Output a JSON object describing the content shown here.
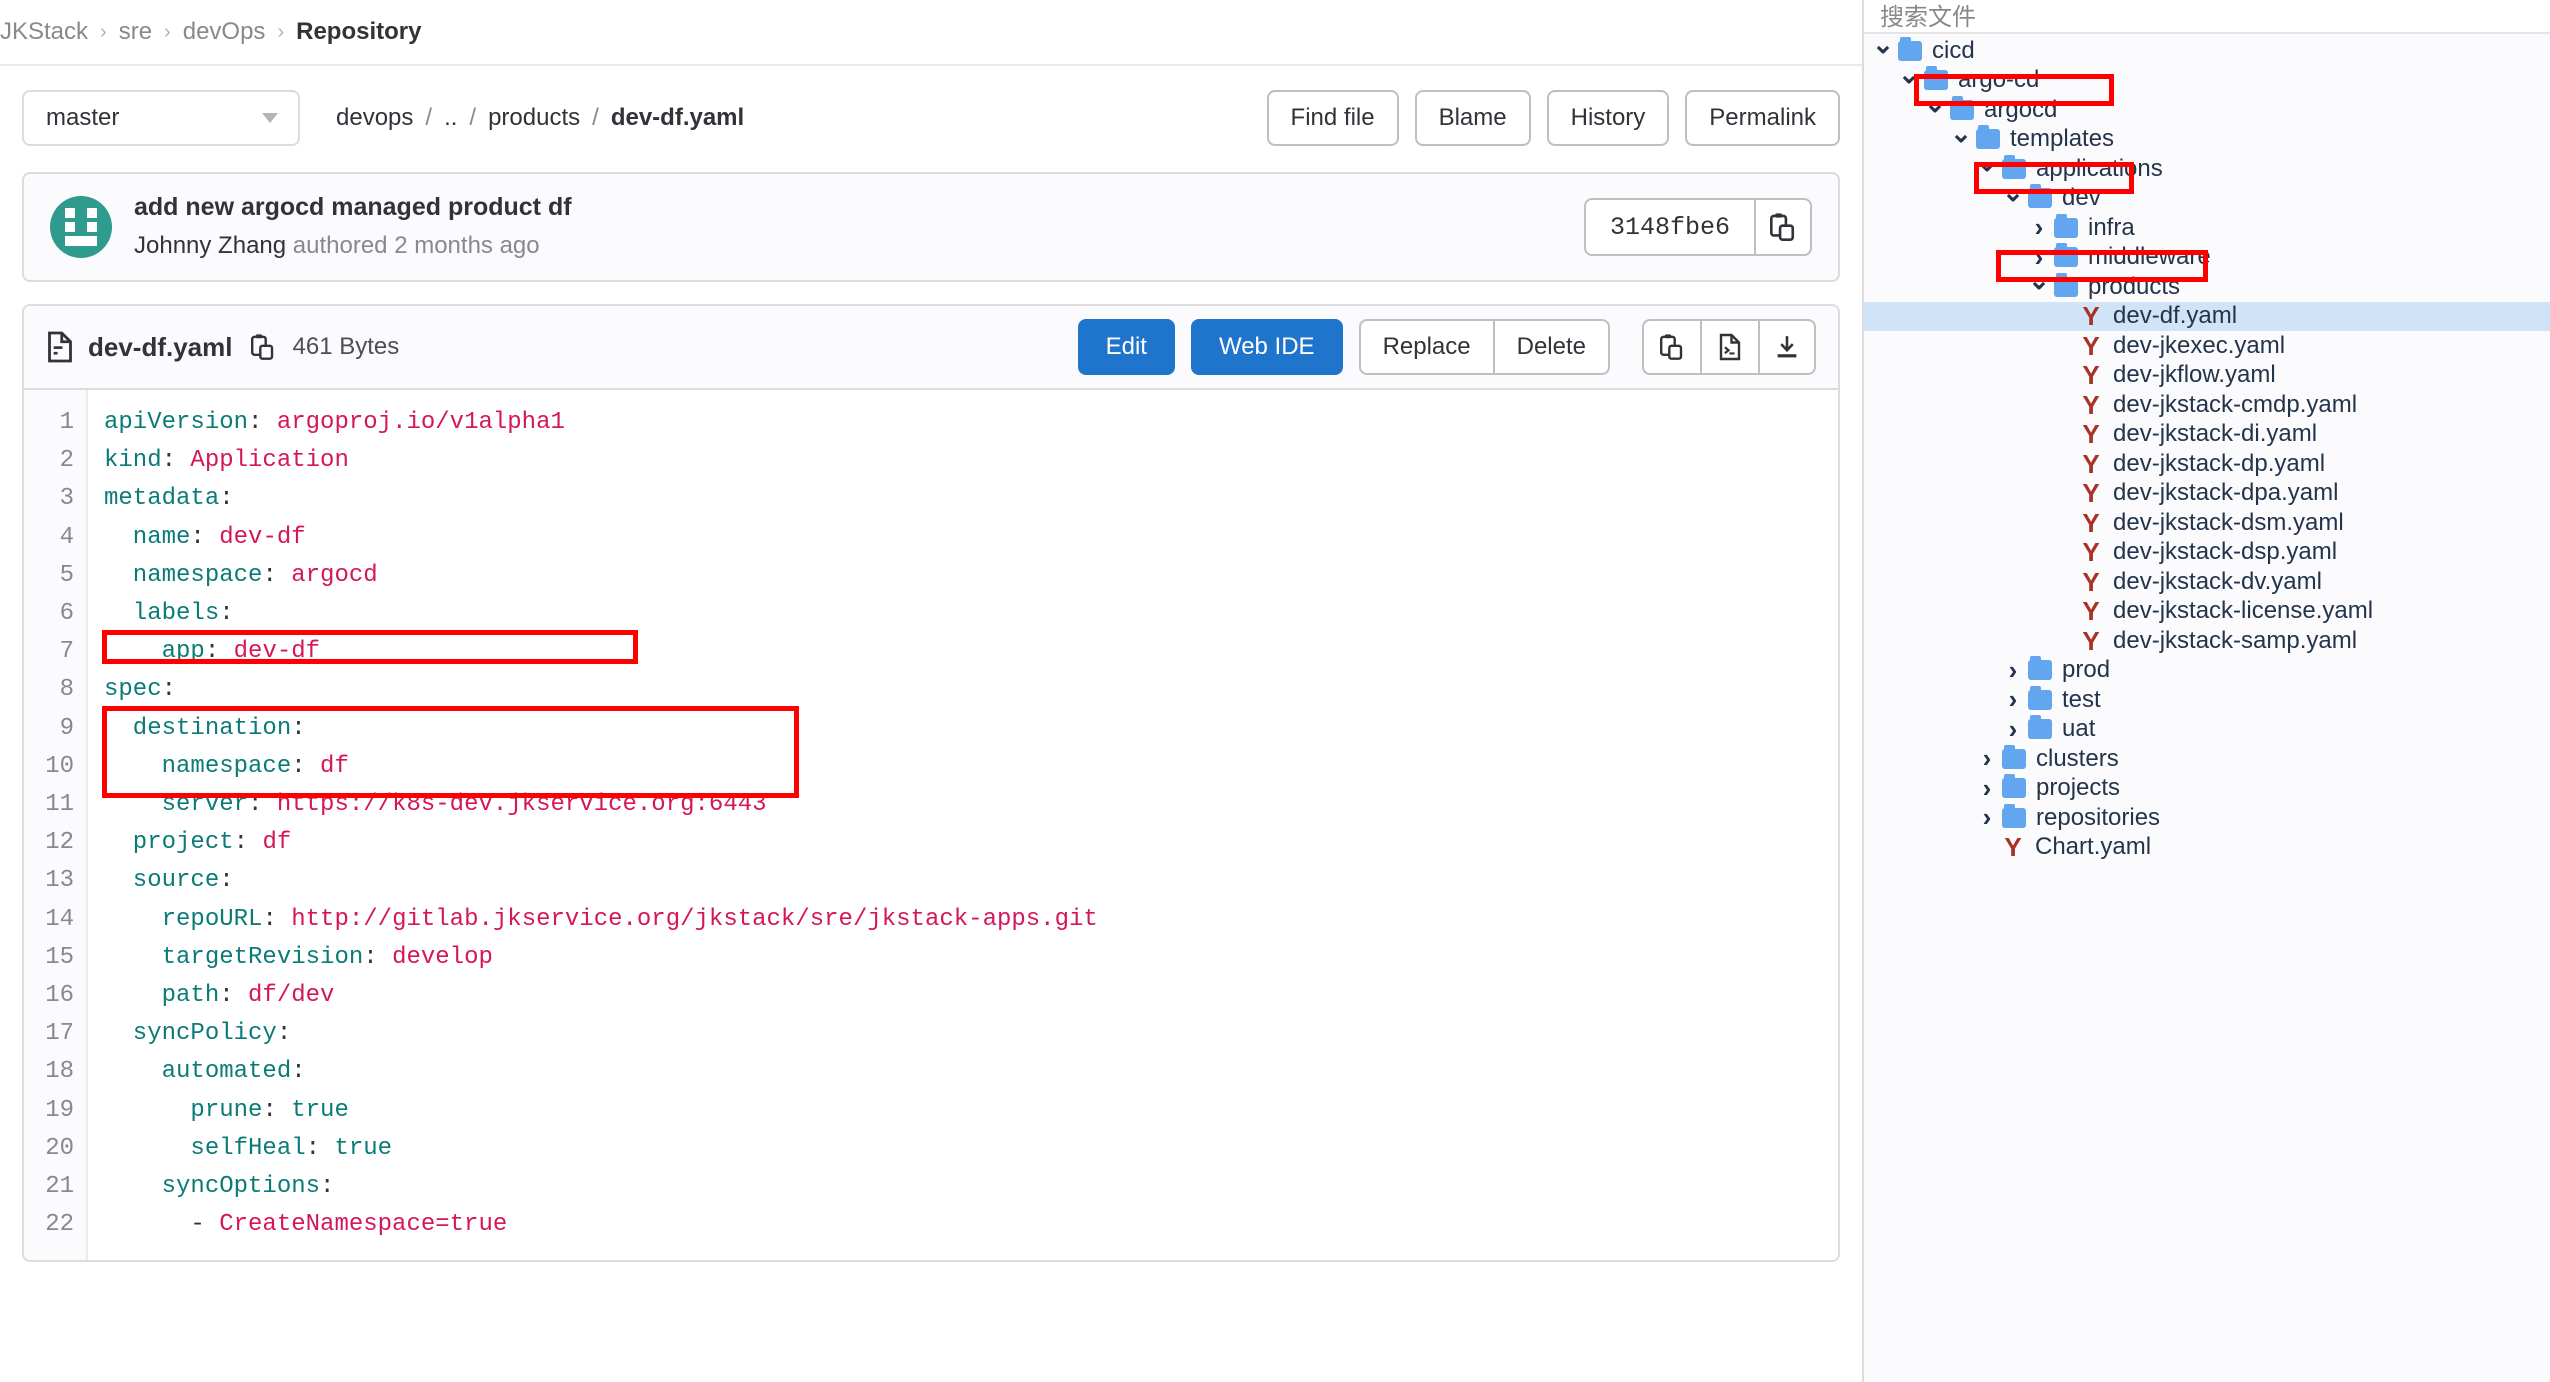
{
  "breadcrumb": {
    "items": [
      "JKStack",
      "sre",
      "devOps",
      "Repository"
    ],
    "separator": "›"
  },
  "toolbar": {
    "branch": "master",
    "path_segments": [
      "devops",
      "..",
      "products",
      "dev-df.yaml"
    ],
    "path_separator": "/",
    "find_file": "Find file",
    "blame": "Blame",
    "history": "History",
    "permalink": "Permalink"
  },
  "commit": {
    "title": "add new argocd managed product df",
    "author": "Johnny Zhang",
    "meta": "authored 2 months ago",
    "sha": "3148fbe6",
    "copy_icon": "clipboard-icon",
    "avatar_icon": "user-avatar"
  },
  "file": {
    "icon": "document-icon",
    "name": "dev-df.yaml",
    "copy_path_icon": "clipboard-icon",
    "size": "461 Bytes",
    "edit": "Edit",
    "web_ide": "Web IDE",
    "replace": "Replace",
    "delete": "Delete",
    "icons": [
      "clipboard-icon",
      "open-raw-icon",
      "download-icon"
    ]
  },
  "code": {
    "language": "yaml",
    "line_numbers": [
      1,
      2,
      3,
      4,
      5,
      6,
      7,
      8,
      9,
      10,
      11,
      12,
      13,
      14,
      15,
      16,
      17,
      18,
      19,
      20,
      21,
      22
    ],
    "lines": [
      {
        "n": 1,
        "indent": 0,
        "key": "apiVersion",
        "value": "argoproj.io/v1alpha1",
        "value_type": "string"
      },
      {
        "n": 2,
        "indent": 0,
        "key": "kind",
        "value": "Application",
        "value_type": "string"
      },
      {
        "n": 3,
        "indent": 0,
        "key": "metadata",
        "value": "",
        "value_type": "map"
      },
      {
        "n": 4,
        "indent": 1,
        "key": "name",
        "value": "dev-df",
        "value_type": "string"
      },
      {
        "n": 5,
        "indent": 1,
        "key": "namespace",
        "value": "argocd",
        "value_type": "string"
      },
      {
        "n": 6,
        "indent": 1,
        "key": "labels",
        "value": "",
        "value_type": "map"
      },
      {
        "n": 7,
        "indent": 2,
        "key": "app",
        "value": "dev-df",
        "value_type": "string"
      },
      {
        "n": 8,
        "indent": 0,
        "key": "spec",
        "value": "",
        "value_type": "map"
      },
      {
        "n": 9,
        "indent": 1,
        "key": "destination",
        "value": "",
        "value_type": "map"
      },
      {
        "n": 10,
        "indent": 2,
        "key": "namespace",
        "value": "df",
        "value_type": "string"
      },
      {
        "n": 11,
        "indent": 2,
        "key": "server",
        "value": "https://k8s-dev.jkservice.org:6443",
        "value_type": "string"
      },
      {
        "n": 12,
        "indent": 1,
        "key": "project",
        "value": "df",
        "value_type": "string"
      },
      {
        "n": 13,
        "indent": 1,
        "key": "source",
        "value": "",
        "value_type": "map"
      },
      {
        "n": 14,
        "indent": 2,
        "key": "repoURL",
        "value": "http://gitlab.jkservice.org/jkstack/sre/jkstack-apps.git",
        "value_type": "string"
      },
      {
        "n": 15,
        "indent": 2,
        "key": "targetRevision",
        "value": "develop",
        "value_type": "string"
      },
      {
        "n": 16,
        "indent": 2,
        "key": "path",
        "value": "df/dev",
        "value_type": "string"
      },
      {
        "n": 17,
        "indent": 1,
        "key": "syncPolicy",
        "value": "",
        "value_type": "map"
      },
      {
        "n": 18,
        "indent": 2,
        "key": "automated",
        "value": "",
        "value_type": "map"
      },
      {
        "n": 19,
        "indent": 3,
        "key": "prune",
        "value": "true",
        "value_type": "bool"
      },
      {
        "n": 20,
        "indent": 3,
        "key": "selfHeal",
        "value": "true",
        "value_type": "bool"
      },
      {
        "n": 21,
        "indent": 2,
        "key": "syncOptions",
        "value": "",
        "value_type": "seq"
      },
      {
        "n": 22,
        "indent": 3,
        "key": "",
        "value": "- CreateNamespace=true",
        "value_type": "item"
      }
    ],
    "annotations": [
      {
        "name": "server-line-highlight",
        "target_line": 11
      },
      {
        "name": "source-block-highlight",
        "target_lines": [
          13,
          14,
          15,
          16
        ]
      }
    ]
  },
  "sidebar": {
    "search_placeholder": "搜索文件",
    "tree": [
      {
        "label": "cicd",
        "depth": 0,
        "type": "folder",
        "state": "open",
        "selected": false,
        "highlighted": false
      },
      {
        "label": "argo-cd",
        "depth": 1,
        "type": "folder",
        "state": "open",
        "selected": false,
        "highlighted": false
      },
      {
        "label": "argocd",
        "depth": 2,
        "type": "folder",
        "state": "open",
        "selected": false,
        "highlighted": true
      },
      {
        "label": "templates",
        "depth": 3,
        "type": "folder",
        "state": "open",
        "selected": false,
        "highlighted": false
      },
      {
        "label": "applications",
        "depth": 4,
        "type": "folder",
        "state": "open",
        "selected": false,
        "highlighted": false
      },
      {
        "label": "dev",
        "depth": 5,
        "type": "folder",
        "state": "open",
        "selected": false,
        "highlighted": true
      },
      {
        "label": "infra",
        "depth": 6,
        "type": "folder",
        "state": "closed",
        "selected": false,
        "highlighted": false
      },
      {
        "label": "middleware",
        "depth": 6,
        "type": "folder",
        "state": "closed",
        "selected": false,
        "highlighted": false
      },
      {
        "label": "products",
        "depth": 6,
        "type": "folder",
        "state": "open",
        "selected": false,
        "highlighted": true
      },
      {
        "label": "dev-df.yaml",
        "depth": 7,
        "type": "yaml",
        "state": "none",
        "selected": true,
        "highlighted": false
      },
      {
        "label": "dev-jkexec.yaml",
        "depth": 7,
        "type": "yaml",
        "state": "none",
        "selected": false,
        "highlighted": false
      },
      {
        "label": "dev-jkflow.yaml",
        "depth": 7,
        "type": "yaml",
        "state": "none",
        "selected": false,
        "highlighted": false
      },
      {
        "label": "dev-jkstack-cmdp.yaml",
        "depth": 7,
        "type": "yaml",
        "state": "none",
        "selected": false,
        "highlighted": false
      },
      {
        "label": "dev-jkstack-di.yaml",
        "depth": 7,
        "type": "yaml",
        "state": "none",
        "selected": false,
        "highlighted": false
      },
      {
        "label": "dev-jkstack-dp.yaml",
        "depth": 7,
        "type": "yaml",
        "state": "none",
        "selected": false,
        "highlighted": false
      },
      {
        "label": "dev-jkstack-dpa.yaml",
        "depth": 7,
        "type": "yaml",
        "state": "none",
        "selected": false,
        "highlighted": false
      },
      {
        "label": "dev-jkstack-dsm.yaml",
        "depth": 7,
        "type": "yaml",
        "state": "none",
        "selected": false,
        "highlighted": false
      },
      {
        "label": "dev-jkstack-dsp.yaml",
        "depth": 7,
        "type": "yaml",
        "state": "none",
        "selected": false,
        "highlighted": false
      },
      {
        "label": "dev-jkstack-dv.yaml",
        "depth": 7,
        "type": "yaml",
        "state": "none",
        "selected": false,
        "highlighted": false
      },
      {
        "label": "dev-jkstack-license.yaml",
        "depth": 7,
        "type": "yaml",
        "state": "none",
        "selected": false,
        "highlighted": false
      },
      {
        "label": "dev-jkstack-samp.yaml",
        "depth": 7,
        "type": "yaml",
        "state": "none",
        "selected": false,
        "highlighted": false
      },
      {
        "label": "prod",
        "depth": 5,
        "type": "folder",
        "state": "closed",
        "selected": false,
        "highlighted": false
      },
      {
        "label": "test",
        "depth": 5,
        "type": "folder",
        "state": "closed",
        "selected": false,
        "highlighted": false
      },
      {
        "label": "uat",
        "depth": 5,
        "type": "folder",
        "state": "closed",
        "selected": false,
        "highlighted": false
      },
      {
        "label": "clusters",
        "depth": 4,
        "type": "folder",
        "state": "closed",
        "selected": false,
        "highlighted": false
      },
      {
        "label": "projects",
        "depth": 4,
        "type": "folder",
        "state": "closed",
        "selected": false,
        "highlighted": false
      },
      {
        "label": "repositories",
        "depth": 4,
        "type": "folder",
        "state": "closed",
        "selected": false,
        "highlighted": false
      },
      {
        "label": "Chart.yaml",
        "depth": 4,
        "type": "yaml",
        "state": "none",
        "selected": false,
        "highlighted": false
      }
    ]
  },
  "colors": {
    "primary": "#1f75cb",
    "annotation": "#ff0000",
    "yaml_key": "#0b7b78",
    "yaml_value": "#d4175c",
    "folder": "#63a6f0",
    "selected_row": "#cfe4f7"
  }
}
